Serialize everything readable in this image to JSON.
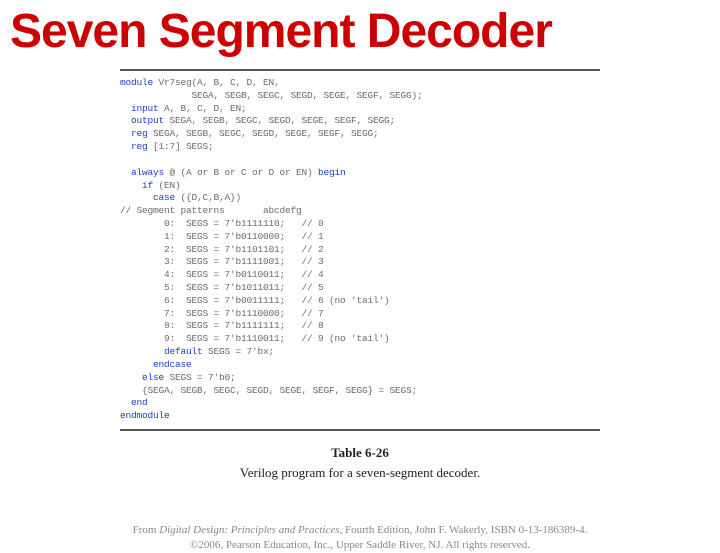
{
  "title": "Seven Segment Decoder",
  "code": {
    "l01a": "module",
    "l01b": " Vr7seg(A, B, C, D, EN,",
    "l02": "             SEGA, SEGB, SEGC, SEGD, SEGE, SEGF, SEGG);",
    "l03a": "  input",
    "l03b": " A, B, C, D, EN;",
    "l04a": "  output",
    "l04b": " SEGA, SEGB, SEGC, SEGD, SEGE, SEGF, SEGG;",
    "l05a": "  reg",
    "l05b": " SEGA, SEGB, SEGC, SEGD, SEGE, SEGF, SEGG;",
    "l06a": "  reg",
    "l06b": " [1:7] SEGS;",
    "blank1": " ",
    "l07a": "  always",
    "l07b": " @ (A or B or C or D or EN) ",
    "l07c": "begin",
    "l08a": "    if",
    "l08b": " (EN)",
    "l09a": "      case",
    "l09b": " ({D,C,B,A})",
    "l10": "// Segment patterns       abcdefg",
    "l11": "        0:  SEGS = 7'b1111110;   // 0",
    "l12": "        1:  SEGS = 7'b0110000;   // 1",
    "l13": "        2:  SEGS = 7'b1101101;   // 2",
    "l14": "        3:  SEGS = 7'b1111001;   // 3",
    "l15": "        4:  SEGS = 7'b0110011;   // 4",
    "l16": "        5:  SEGS = 7'b1011011;   // 5",
    "l17": "        6:  SEGS = 7'b0011111;   // 6 (no 'tail')",
    "l18": "        7:  SEGS = 7'b1110000;   // 7",
    "l19": "        8:  SEGS = 7'b1111111;   // 8",
    "l20": "        9:  SEGS = 7'b1110011;   // 9 (no 'tail')",
    "l21a": "        default",
    "l21b": " SEGS = 7'bx;",
    "l22": "      endcase",
    "l23a": "    else",
    "l23b": " SEGS = 7'b0;",
    "l24": "    {SEGA, SEGB, SEGC, SEGD, SEGE, SEGF, SEGG} = SEGS;",
    "l25": "  end",
    "l26": "endmodule"
  },
  "caption": {
    "table_label": "Table 6-26",
    "text": "Verilog program for a seven-segment decoder."
  },
  "footer": {
    "line1a": "From ",
    "line1b": "Digital Design: Principles and Practices",
    "line1c": ", Fourth Edition, John F. Wakerly, ISBN 0-13-186389-4.",
    "line2": "©2006, Pearson Education, Inc., Upper Saddle River, NJ. All rights reserved."
  }
}
